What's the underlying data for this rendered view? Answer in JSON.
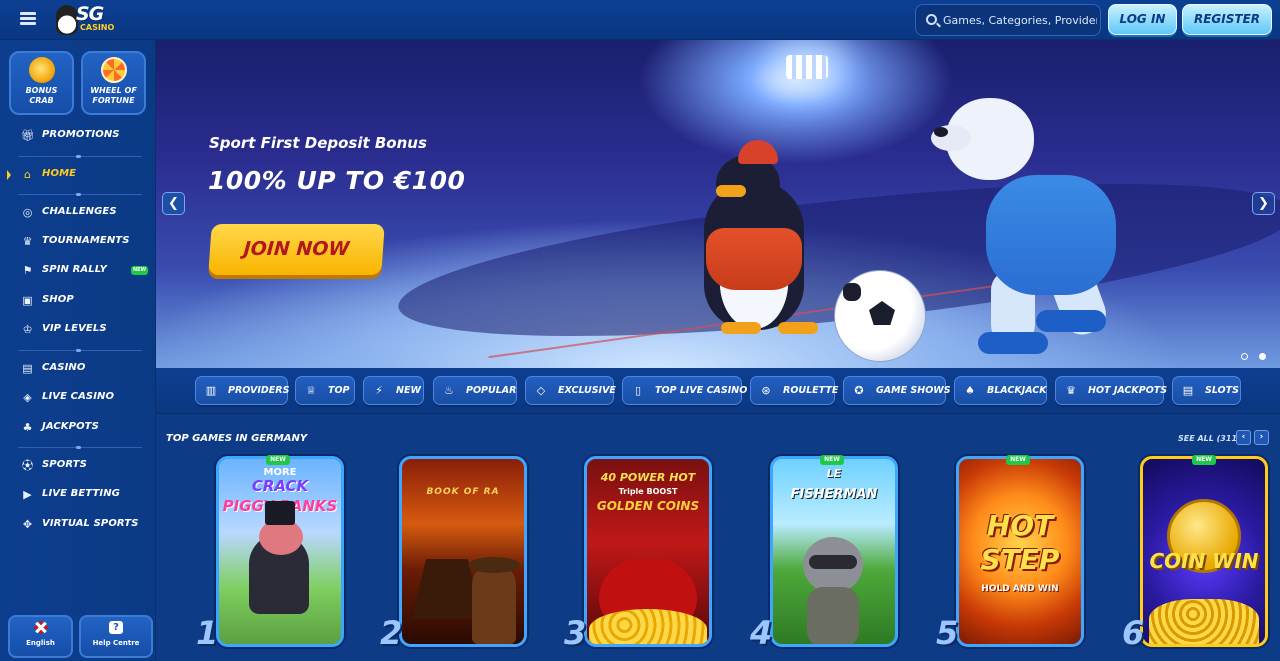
{
  "brand": {
    "name": "SG",
    "tagline": "CASINO"
  },
  "search": {
    "placeholder": "Games, Categories, Providers"
  },
  "auth": {
    "login_label": "LOG IN",
    "register_label": "REGISTER"
  },
  "sidebar": {
    "tiles": [
      {
        "label_line1": "BONUS",
        "label_line2": "CRAB"
      },
      {
        "label_line1": "WHEEL OF",
        "label_line2": "FORTUNE"
      }
    ],
    "items": [
      {
        "label": "PROMOTIONS",
        "icon": "gift-icon"
      },
      {
        "label": "HOME",
        "icon": "home-icon",
        "active": true
      },
      {
        "label": "CHALLENGES",
        "icon": "target-icon"
      },
      {
        "label": "TOURNAMENTS",
        "icon": "trophy-icon"
      },
      {
        "label": "SPIN RALLY",
        "icon": "flag-icon",
        "badge": "NEW"
      },
      {
        "label": "SHOP",
        "icon": "bag-icon"
      },
      {
        "label": "VIP LEVELS",
        "icon": "crown-icon"
      },
      {
        "label": "CASINO",
        "icon": "slot-icon"
      },
      {
        "label": "LIVE CASINO",
        "icon": "chip-icon"
      },
      {
        "label": "JACKPOTS",
        "icon": "clover-icon"
      },
      {
        "label": "SPORTS",
        "icon": "soccer-ball-icon"
      },
      {
        "label": "LIVE BETTING",
        "icon": "play-icon"
      },
      {
        "label": "VIRTUAL SPORTS",
        "icon": "gamepad-icon"
      }
    ],
    "footer": {
      "language_label": "English",
      "help_label": "Help Centre"
    }
  },
  "hero": {
    "subtitle": "Sport First Deposit Bonus",
    "title": "100% UP TO €100",
    "cta_label": "JOIN NOW",
    "slide_count": 2,
    "active_slide": 2
  },
  "categories": [
    {
      "label": "PROVIDERS",
      "icon": "book-icon"
    },
    {
      "label": "TOP",
      "icon": "crown-icon"
    },
    {
      "label": "NEW",
      "icon": "lightning-icon"
    },
    {
      "label": "POPULAR",
      "icon": "flame-icon"
    },
    {
      "label": "EXCLUSIVE",
      "icon": "diamond-icon"
    },
    {
      "label": "TOP LIVE CASINO",
      "icon": "cards-icon"
    },
    {
      "label": "ROULETTE",
      "icon": "roulette-icon"
    },
    {
      "label": "GAME SHOWS",
      "icon": "wheel-icon"
    },
    {
      "label": "BLACKJACK",
      "icon": "spade-icon"
    },
    {
      "label": "HOT JACKPOTS",
      "icon": "pot-icon"
    },
    {
      "label": "SLOTS",
      "icon": "slot-icon"
    }
  ],
  "games_section": {
    "title": "TOP GAMES IN GERMANY",
    "see_all": "SEE ALL (311)",
    "games": [
      {
        "rank": "1",
        "new": "NEW",
        "line1": "CRACK",
        "line2": "PIGGY BANKS",
        "line3": "MORE"
      },
      {
        "rank": "2",
        "new": "",
        "line1": "BOOK OF RA",
        "line2": "",
        "line3": ""
      },
      {
        "rank": "3",
        "new": "",
        "line1": "40 POWER HOT",
        "line2": "GOLDEN COINS",
        "line3": "Triple BOOST"
      },
      {
        "rank": "4",
        "new": "NEW",
        "line1": "LE",
        "line2": "FISHERMAN",
        "line3": ""
      },
      {
        "rank": "5",
        "new": "NEW",
        "line1": "HOT",
        "line2": "STEP",
        "line3": "HOLD AND WIN"
      },
      {
        "rank": "6",
        "new": "NEW",
        "line1": "COIN WIN",
        "line2": "",
        "line3": ""
      }
    ]
  }
}
